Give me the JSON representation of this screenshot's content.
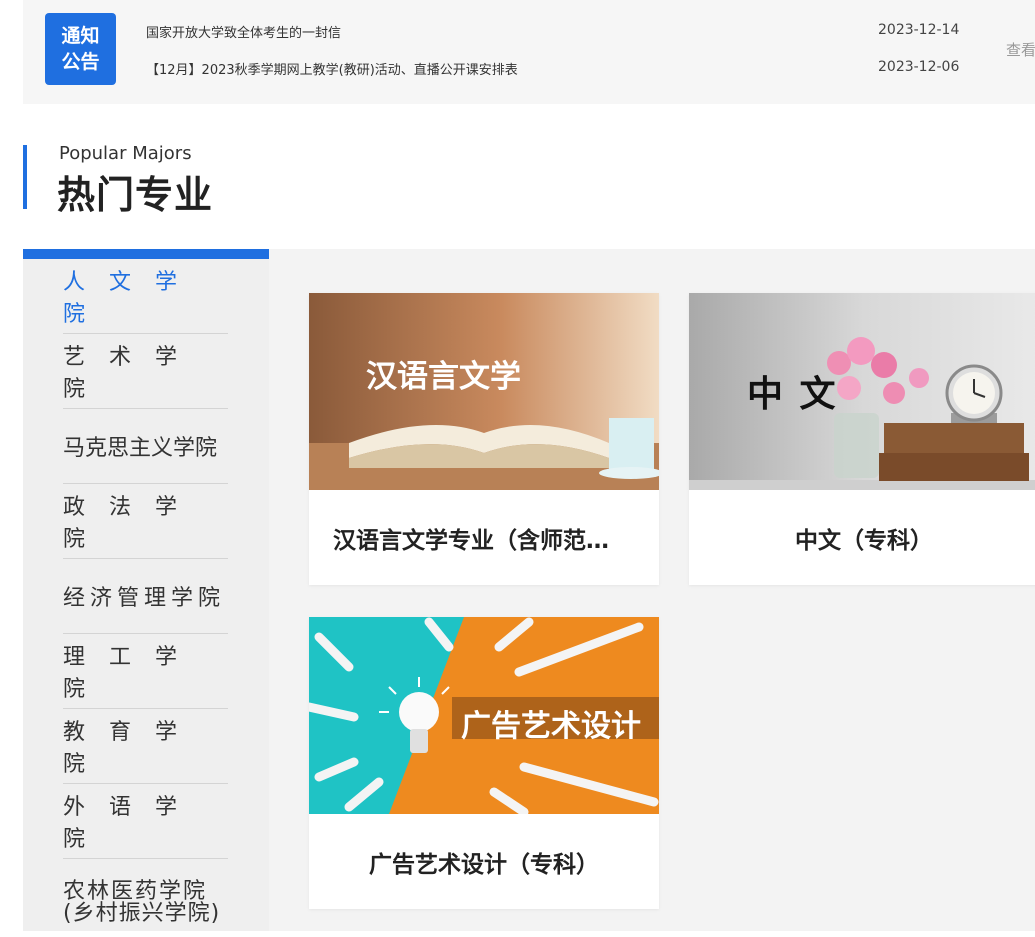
{
  "notice": {
    "badge_line1": "通知",
    "badge_line2": "公告",
    "items": [
      {
        "title": "国家开放大学致全体考生的一封信",
        "date": "2023-12-14"
      },
      {
        "title": "【12月】2023秋季学期网上教学(教研)活动、直播公开课安排表",
        "date": "2023-12-06"
      }
    ],
    "more": "查看更多"
  },
  "section": {
    "title_en": "Popular Majors",
    "title_cn": "热门专业"
  },
  "colleges": [
    "人文学院",
    "艺术学院",
    "马克思主义学院",
    "政法学院",
    "经济管理学院",
    "理工学院",
    "教育学院",
    "外语学院",
    "农林医药学院",
    "(乡村振兴学院)"
  ],
  "majors": [
    {
      "image_text": "汉语言文学",
      "title": "汉语言文学专业（含师范…"
    },
    {
      "image_text": "中 文",
      "title": "中文（专科）"
    },
    {
      "image_text": "广告艺术设计",
      "title": "广告艺术设计（专科）"
    }
  ],
  "colors": {
    "accent": "#1f6fe0",
    "orange": "#ee8a1f",
    "teal": "#1fc3c5"
  },
  "icons": {
    "clock": "alarm-clock-icon",
    "bulb": "light-bulb-icon"
  }
}
